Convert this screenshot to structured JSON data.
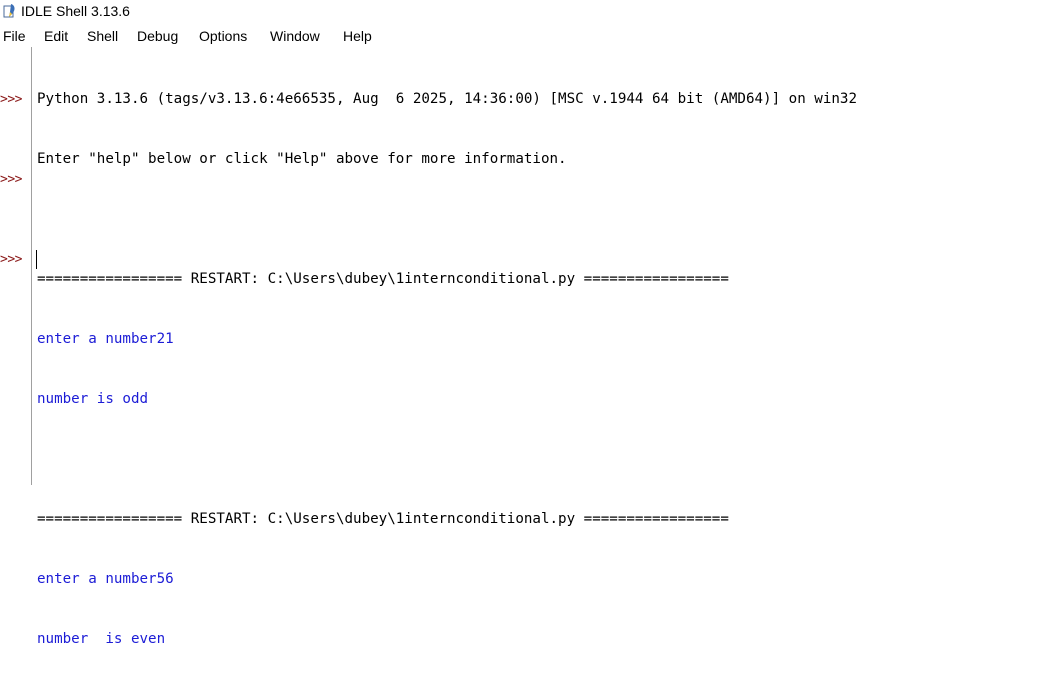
{
  "window": {
    "title": "IDLE Shell 3.13.6",
    "icon": "python-feather-icon"
  },
  "menubar": {
    "items": [
      {
        "label": "File"
      },
      {
        "label": "Edit"
      },
      {
        "label": "Shell"
      },
      {
        "label": "Debug"
      },
      {
        "label": "Options"
      },
      {
        "label": "Window"
      },
      {
        "label": "Help"
      }
    ]
  },
  "shell": {
    "prompt": ">>>",
    "banner": [
      "Python 3.13.6 (tags/v3.13.6:4e66535, Aug  6 2025, 14:36:00) [MSC v.1944 64 bit (AMD64)] on win32",
      "Enter \"help\" below or click \"Help\" above for more information."
    ],
    "sessions": [
      {
        "restart": "================= RESTART: C:\\Users\\dubey\\1internconditional.py =================",
        "io_lines": [
          "enter a number21",
          "number is odd"
        ]
      },
      {
        "restart": "================= RESTART: C:\\Users\\dubey\\1internconditional.py =================",
        "io_lines": [
          "enter a number56",
          "number  is even"
        ]
      }
    ]
  },
  "colors": {
    "prompt": "#8b1a1a",
    "io_text": "#1c1cd6",
    "stdout_text": "#000000"
  }
}
